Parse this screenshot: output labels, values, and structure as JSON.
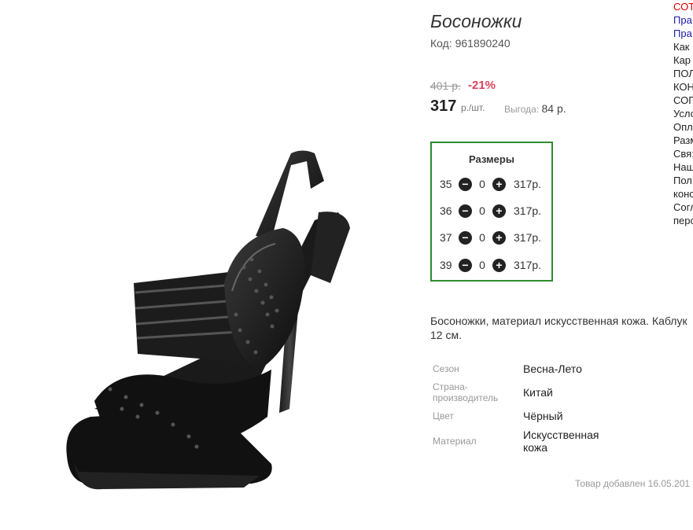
{
  "product": {
    "title": "Босоножки",
    "code": "Код: 961890240",
    "old_price": "401 р.",
    "discount": "-21%",
    "price": "317",
    "price_unit": "р./шт.",
    "savings_label": "Выгода:",
    "savings_value": "84 р.",
    "description": "Босоножки, материал искусственная кожа. Каблук 12 см.",
    "added": "Товар добавлен 16.05.201"
  },
  "sizes": {
    "title": "Размеры",
    "rows": [
      {
        "size": "35",
        "qty": "0",
        "price": "317р."
      },
      {
        "size": "36",
        "qty": "0",
        "price": "317р."
      },
      {
        "size": "37",
        "qty": "0",
        "price": "317р."
      },
      {
        "size": "39",
        "qty": "0",
        "price": "317р."
      }
    ]
  },
  "attributes": [
    {
      "label": "Сезон",
      "value": "Весна-Лето"
    },
    {
      "label": "Страна-производитель",
      "value": "Китай"
    },
    {
      "label": "Цвет",
      "value": "Чёрный"
    },
    {
      "label": "Материал",
      "value": "Искусственная кожа"
    }
  ],
  "side_menu": [
    {
      "text": "СОТ",
      "color": "#d00000"
    },
    {
      "text": "Пра",
      "color": "#1a1aa6"
    },
    {
      "text": "Пра",
      "color": "#1a1aa6"
    },
    {
      "text": "Как",
      "color": "#222222"
    },
    {
      "text": "Кар",
      "color": "#222222"
    },
    {
      "text": "ПОЛ",
      "color": "#222222"
    },
    {
      "text": "КОН",
      "color": "#222222"
    },
    {
      "text": "СОГ",
      "color": "#222222"
    },
    {
      "text": "Усло",
      "color": "#222222"
    },
    {
      "text": "Опл",
      "color": "#222222"
    },
    {
      "text": "Разм",
      "color": "#222222"
    },
    {
      "text": "Свя:",
      "color": "#222222"
    },
    {
      "text": "Нащ",
      "color": "#222222"
    },
    {
      "text": "Пол",
      "color": "#222222"
    },
    {
      "text": "конс",
      "color": "#222222"
    },
    {
      "text": "Согл",
      "color": "#222222"
    },
    {
      "text": "перс",
      "color": "#222222"
    }
  ],
  "icons": {
    "minus": "minus-circle-icon",
    "plus": "plus-circle-icon"
  },
  "colors": {
    "accent_border": "#2e8b2e",
    "discount": "#d8405a"
  }
}
